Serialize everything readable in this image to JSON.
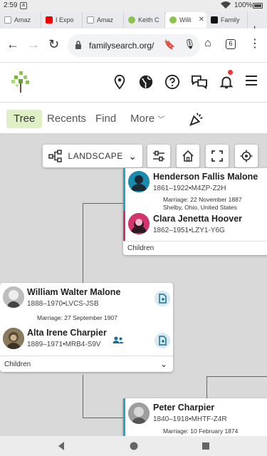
{
  "status": {
    "time": "2:59",
    "notification": "a",
    "battery": "100%"
  },
  "browser_tabs": [
    {
      "label": "Amaz",
      "icon": "amazon-icon"
    },
    {
      "label": "I Expo",
      "icon": "youtube-icon"
    },
    {
      "label": "Amaz",
      "icon": "amazon-icon"
    },
    {
      "label": "Keith C",
      "icon": "tree-icon"
    },
    {
      "label": "Willi",
      "icon": "tree-icon",
      "active": true
    },
    {
      "label": "Family",
      "icon": "family-icon"
    }
  ],
  "address": {
    "url": "familysearch.org/",
    "tab_count": "6"
  },
  "subnav": {
    "tree": "Tree",
    "recents": "Recents",
    "find": "Find",
    "more": "More"
  },
  "toolbar": {
    "layout": "LANDSCAPE"
  },
  "couple1": {
    "husband": {
      "name": "Henderson Fallis Malone",
      "dates": "1861–1922",
      "id": "M4ZP-Z2H"
    },
    "marriage": "Marriage: 22 November 1887",
    "marriage_place": "Shelby, Ohio, United States",
    "wife": {
      "name": "Clara Jenetta Hoover",
      "dates": "1862–1951",
      "id": "LZY1-Y6G"
    },
    "children": "Children"
  },
  "couple2": {
    "husband": {
      "name": "William Walter Malone",
      "dates": "1888–1970",
      "id": "LVCS-JSB"
    },
    "marriage": "Marriage: 27 September 1907",
    "wife": {
      "name": "Alta Irene Charpier",
      "dates": "1889–1971",
      "id": "MRB4-S9V"
    },
    "children": "Children"
  },
  "couple3": {
    "husband": {
      "name": "Peter Charpier",
      "dates": "1840–1918",
      "id": "MHTF-Z4R"
    },
    "marriage": "Marriage: 10 February 1874"
  },
  "colors": {
    "male": "#1fa7c8",
    "female": "#d4336e",
    "active_tab": "#dfefc6"
  }
}
